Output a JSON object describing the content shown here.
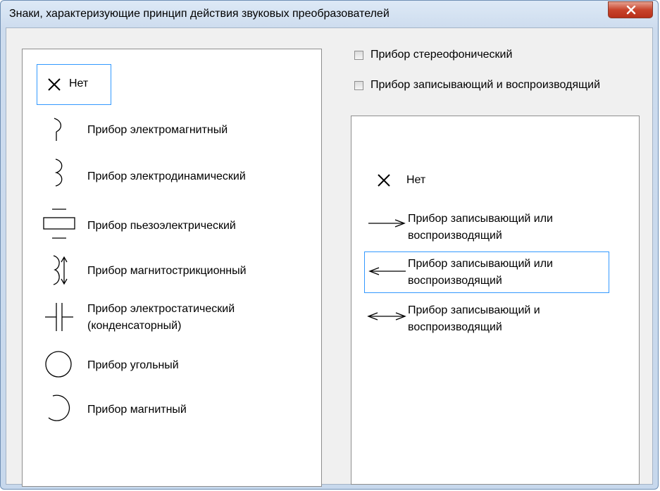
{
  "window": {
    "title": "Знаки, характеризующие принцип действия звуковых преобразователей"
  },
  "left_list": {
    "items": [
      {
        "label": "Нет",
        "icon": "cross-icon",
        "selected": true
      },
      {
        "label": "Прибор электромагнитный",
        "icon": "electromagnetic-icon"
      },
      {
        "label": "Прибор электродинамический",
        "icon": "electrodynamic-icon"
      },
      {
        "label": "Прибор пьезоэлектрический",
        "icon": "piezoelectric-icon"
      },
      {
        "label": "Прибор магнитострикционный",
        "icon": "magnetostrictive-icon"
      },
      {
        "label_line1": "Прибор электростатический",
        "label_line2": "(конденсаторный)",
        "icon": "electrostatic-icon"
      },
      {
        "label": "Прибор угольный",
        "icon": "circle-icon"
      },
      {
        "label": "Прибор магнитный",
        "icon": "arc-icon"
      }
    ]
  },
  "options": {
    "stereo": {
      "label": "Прибор стереофонический",
      "checked": false
    },
    "record_play": {
      "label": "Прибор записывающий и воспроизводящий",
      "checked": false
    }
  },
  "right_list": {
    "items": [
      {
        "label": "Нет",
        "icon": "cross-icon"
      },
      {
        "label_line1": "Прибор записывающий или",
        "label_line2": "воспроизводящий",
        "icon": "arrow-right-icon"
      },
      {
        "label_line1": "Прибор записывающий или",
        "label_line2": "воспроизводящий",
        "icon": "arrow-left-icon",
        "selected": true
      },
      {
        "label_line1": "Прибор записывающий и",
        "label_line2": "воспроизводящий",
        "icon": "arrow-both-icon"
      }
    ]
  },
  "colors": {
    "selection_border": "#3399ff",
    "close_button": "#c8442c"
  }
}
